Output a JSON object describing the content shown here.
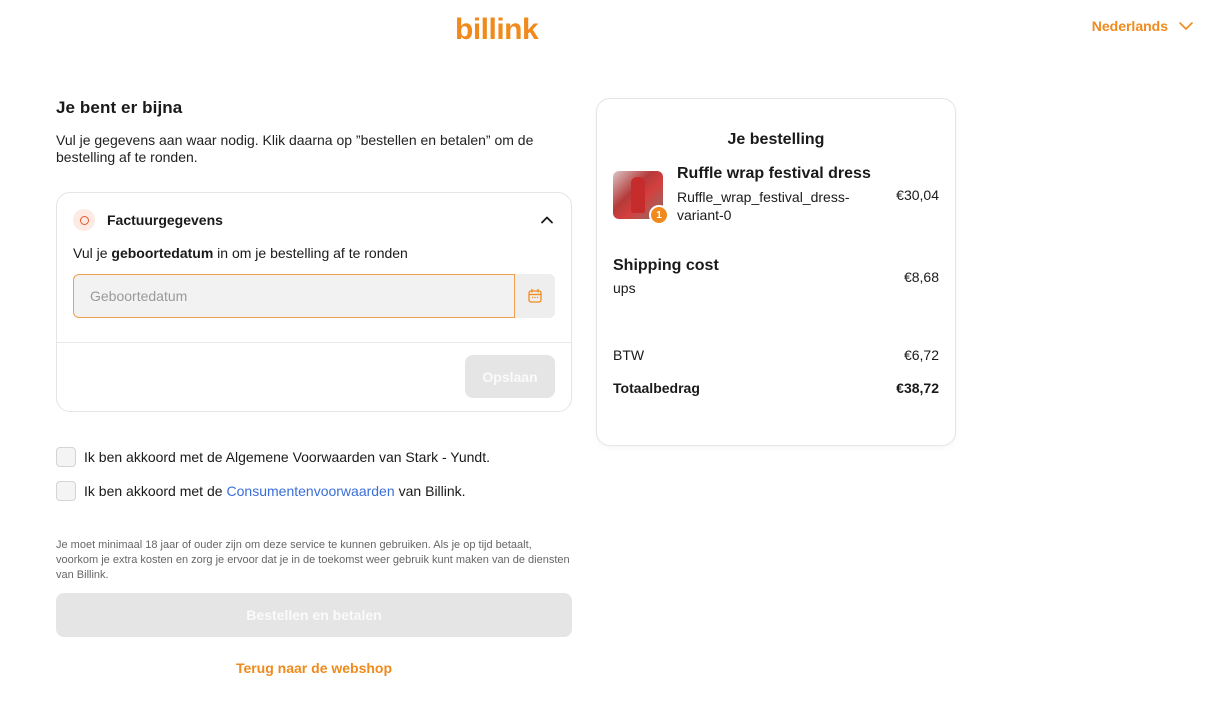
{
  "header": {
    "logo_text": "billink",
    "language": "Nederlands",
    "brand_color": "#f08a1c"
  },
  "intro": {
    "title": "Je bent er bijna",
    "text": "Vul je gegevens aan waar nodig. Klik daarna op ”bestellen en betalen” om de bestelling af te ronden."
  },
  "billing": {
    "title": "Factuurgegevens",
    "instruction_pre": "Vul je ",
    "instruction_bold": "geboortedatum",
    "instruction_post": " in om je bestelling af te ronden",
    "date_placeholder": "Geboortedatum",
    "date_value": "",
    "save_label": "Opslaan"
  },
  "consent": {
    "terms_text": "Ik ben akkoord met de Algemene Voorwaarden van Stark - Yundt.",
    "consumer_pre": "Ik ben akkoord met de",
    "consumer_link": "Consumentenvoorwaarden",
    "consumer_post": "van Billink."
  },
  "disclaimer": "Je moet minimaal 18 jaar of ouder zijn om deze service te kunnen gebruiken. Als je op tijd betaalt, voorkom je extra kosten en zorg je ervoor dat je in de toekomst weer gebruik kunt maken van de diensten van Billink.",
  "actions": {
    "order_label": "Bestellen en betalen",
    "back_label": "Terug naar de webshop"
  },
  "order": {
    "title": "Je bestelling",
    "product": {
      "name": "Ruffle wrap festival dress",
      "variant": "Ruffle_wrap_festival_dress-variant-0",
      "quantity": "1",
      "price": "€30,04"
    },
    "shipping": {
      "label": "Shipping cost",
      "carrier": "ups",
      "price": "€8,68"
    },
    "tax": {
      "label": "BTW",
      "value": "€6,72"
    },
    "total": {
      "label": "Totaalbedrag",
      "value": "€38,72"
    }
  }
}
